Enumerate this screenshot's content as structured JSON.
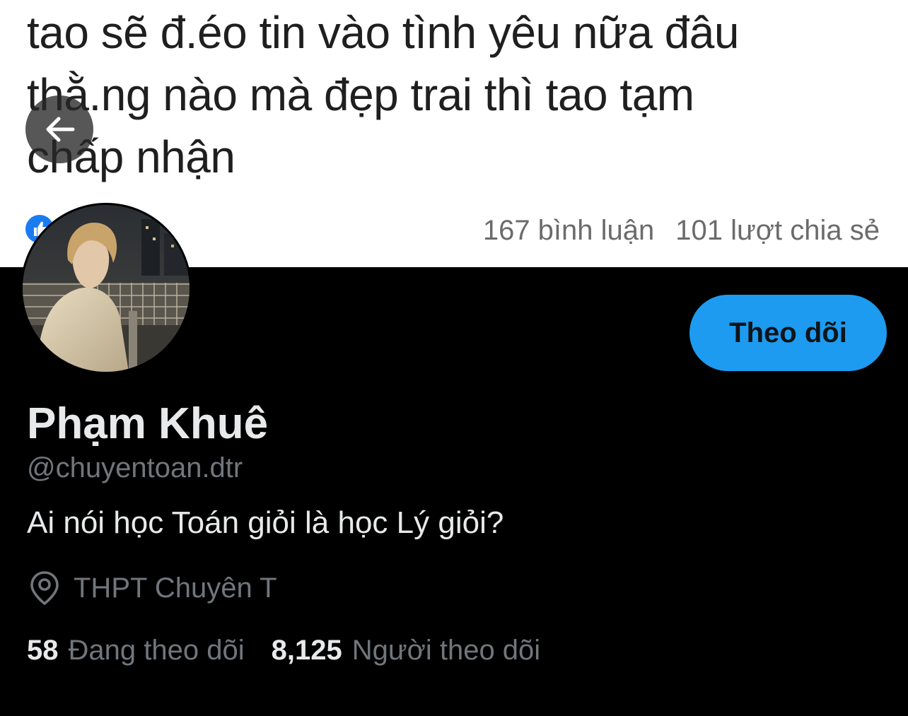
{
  "banner": {
    "post_lines": [
      "tao sẽ đ.éo tin vào tình yêu nữa đâu",
      "thằ.ng nào mà đẹp trai thì tao tạm",
      "chấp nhận"
    ],
    "comments": "167 bình luận",
    "shares": "101 lượt chia sẻ"
  },
  "header": {
    "back_icon": "arrow-left-icon"
  },
  "profile": {
    "display_name": "Phạm Khuê",
    "handle": "@chuyentoan.dtr",
    "bio": "Ai nói học Toán giỏi là học Lý giỏi?",
    "location": "THPT Chuyên T",
    "location_icon": "location-pin-icon",
    "follow_label": "Theo dõi",
    "following_count": "58",
    "following_label": "Đang theo dõi",
    "followers_count": "8,125",
    "followers_label": "Người theo dõi"
  },
  "colors": {
    "background": "#000000",
    "accent": "#1d9bf0",
    "primary_text": "#e7e9ea",
    "secondary_text": "#71767b",
    "banner_background": "#ffffff"
  }
}
